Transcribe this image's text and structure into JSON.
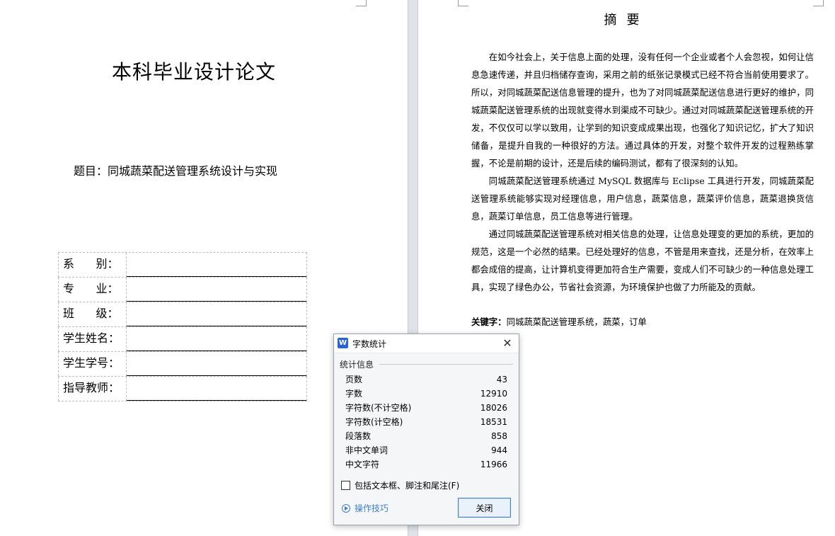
{
  "cover": {
    "title": "本科毕业设计论文",
    "topic": "题目：同城蔬菜配送管理系统设计与实现",
    "fields": [
      {
        "label": "系      别："
      },
      {
        "label": "专      业："
      },
      {
        "label": "班      级："
      },
      {
        "label": "学生姓名："
      },
      {
        "label": "学生学号："
      },
      {
        "label": "指导教师："
      }
    ]
  },
  "abstract": {
    "title": "摘要",
    "paragraphs": [
      "在如今社会上，关于信息上面的处理，没有任何一个企业或者个人会忽视，如何让信息急速传递，并且归档储存查询，采用之前的纸张记录模式已经不符合当前使用要求了。所以，对同城蔬菜配送信息管理的提升，也为了对同城蔬菜配送信息进行更好的维护，同城蔬菜配送管理系统的出现就变得水到渠成不可缺少。通过对同城蔬菜配送管理系统的开发，不仅仅可以学以致用，让学到的知识变成成果出现，也强化了知识记忆，扩大了知识储备，是提升自我的一种很好的方法。通过具体的开发，对整个软件开发的过程熟练掌握，不论是前期的设计，还是后续的编码测试，都有了很深刻的认知。",
      "同城蔬菜配送管理系统通过 MySQL 数据库与 Eclipse 工具进行开发，同城蔬菜配送管理系统能够实现对经理信息，用户信息，蔬菜信息，蔬菜评价信息，蔬菜退换货信息，蔬菜订单信息，员工信息等进行管理。",
      "通过同城蔬菜配送管理系统对相关信息的处理，让信息处理变的更加的系统，更加的规范，这是一个必然的结果。已经处理好的信息，不管是用来查找，还是分析，在效率上都会成倍的提高，让计算机变得更加符合生产需要，变成人们不可缺少的一种信息处理工具，实现了绿色办公，节省社会资源，为环境保护也做了力所能及的贡献。"
    ],
    "keywords_label": "关键字：",
    "keywords": "同城蔬菜配送管理系统，蔬菜，订单"
  },
  "dialog": {
    "app_icon": "W",
    "title": "字数统计",
    "group_label": "统计信息",
    "stats": [
      {
        "label": "页数",
        "value": "43"
      },
      {
        "label": "字数",
        "value": "12910"
      },
      {
        "label": "字符数(不计空格)",
        "value": "18026"
      },
      {
        "label": "字符数(计空格)",
        "value": "18531"
      },
      {
        "label": "段落数",
        "value": "858"
      },
      {
        "label": "非中文单词",
        "value": "944"
      },
      {
        "label": "中文字符",
        "value": "11966"
      }
    ],
    "checkbox_label": "包括文本框、脚注和尾注(F)",
    "tips_label": "操作技巧",
    "close_button": "关闭",
    "close_glyph": "✕"
  }
}
